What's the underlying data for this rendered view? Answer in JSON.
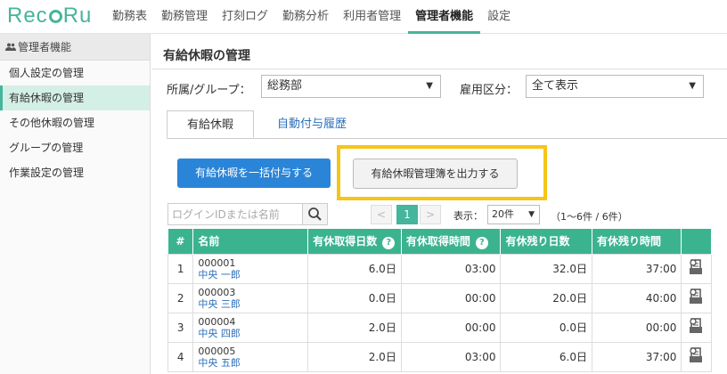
{
  "app": {
    "logo_pre": "Rec",
    "logo_post": "Ru"
  },
  "nav": [
    "勤務表",
    "勤務管理",
    "打刻ログ",
    "勤務分析",
    "利用者管理",
    "管理者機能",
    "設定"
  ],
  "sidebar": {
    "header": "管理者機能",
    "items": [
      "個人設定の管理",
      "有給休暇の管理",
      "その他休暇の管理",
      "グループの管理",
      "作業設定の管理"
    ]
  },
  "page": {
    "title": "有給休暇の管理",
    "group_label": "所属/グループ：",
    "group_value": "総務部",
    "employment_label": "雇用区分：",
    "employment_value": "全て表示"
  },
  "tabs": [
    "有給休暇",
    "自動付与履歴"
  ],
  "actions": {
    "bulk_grant": "有給休暇を一括付与する",
    "export": "有給休暇管理簿を出力する"
  },
  "search": {
    "placeholder": "ログインIDまたは名前"
  },
  "pagination": {
    "prev": "<",
    "current": "1",
    "next": ">",
    "display_label": "表示：",
    "per_page": "20件",
    "range": "（1〜6件 / 6件）"
  },
  "table": {
    "headers": [
      "#",
      "名前",
      "有休取得日数",
      "有休取得時間",
      "有休残り日数",
      "有休残り時間"
    ],
    "rows": [
      {
        "num": "1",
        "id": "000001",
        "name": "中央 一郎",
        "taken_days": "6.0日",
        "taken_hours": "03:00",
        "remain_days": "32.0日",
        "remain_hours": "37:00"
      },
      {
        "num": "2",
        "id": "000003",
        "name": "中央 三郎",
        "taken_days": "0.0日",
        "taken_hours": "00:00",
        "remain_days": "20.0日",
        "remain_hours": "40:00"
      },
      {
        "num": "3",
        "id": "000004",
        "name": "中央 四郎",
        "taken_days": "2.0日",
        "taken_hours": "00:00",
        "remain_days": "0.0日",
        "remain_hours": "00:00"
      },
      {
        "num": "4",
        "id": "000005",
        "name": "中央 五郎",
        "taken_days": "2.0日",
        "taken_hours": "03:00",
        "remain_days": "6.0日",
        "remain_hours": "37:00"
      }
    ]
  },
  "colors": {
    "accent": "#45b59b",
    "header": "#3cb38f",
    "primary": "#2a85d8",
    "highlight": "#f5c518",
    "link": "#2a6ebb"
  }
}
